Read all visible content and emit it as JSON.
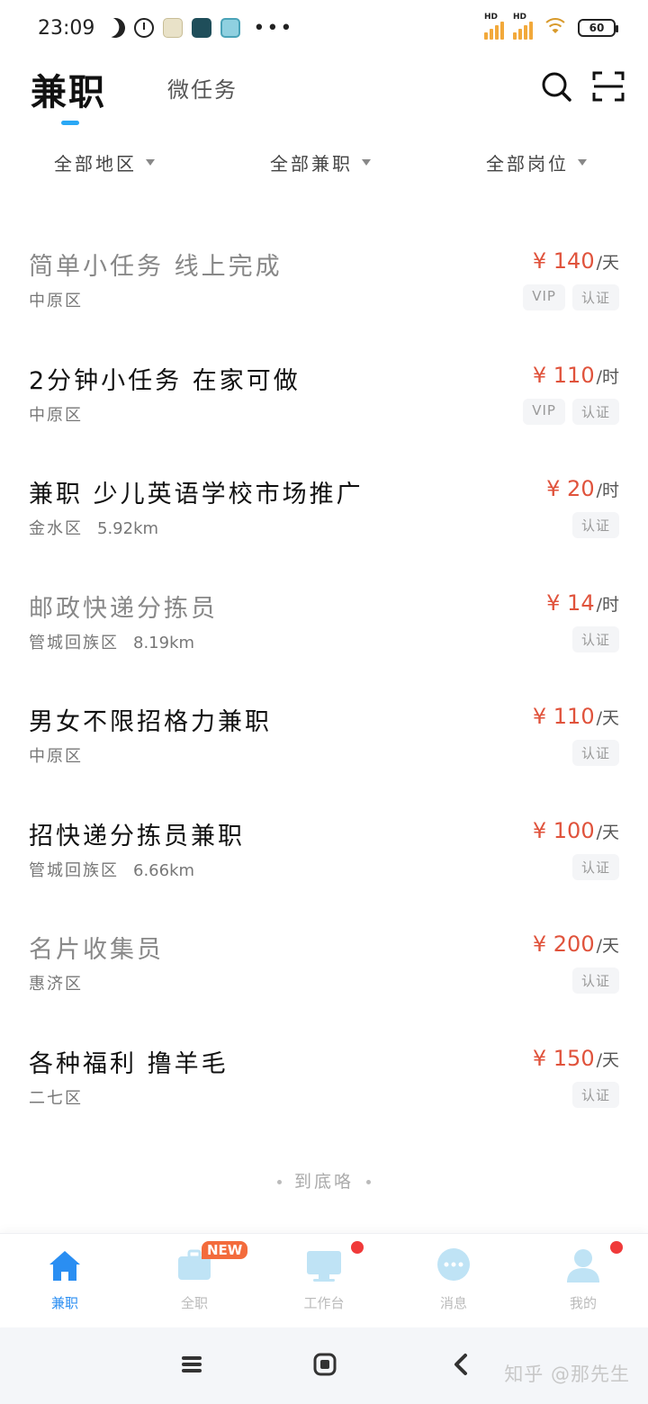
{
  "status_bar": {
    "time": "23:09",
    "signal_label_1": "HD",
    "signal_label_2": "HD",
    "battery": "60"
  },
  "header": {
    "active_tab": "兼职",
    "other_tab": "微任务"
  },
  "filters": [
    {
      "label": "全部地区"
    },
    {
      "label": "全部兼职"
    },
    {
      "label": "全部岗位"
    }
  ],
  "jobs": [
    {
      "title": "简单小任务 线上完成",
      "location": "中原区",
      "distance": "",
      "price": "¥ 140",
      "unit": "/天",
      "tags": [
        "VIP",
        "认证"
      ],
      "faded": true
    },
    {
      "title": "2分钟小任务 在家可做",
      "location": "中原区",
      "distance": "",
      "price": "¥ 110",
      "unit": "/时",
      "tags": [
        "VIP",
        "认证"
      ],
      "faded": false
    },
    {
      "title": "兼职  少儿英语学校市场推广",
      "location": "金水区",
      "distance": "5.92km",
      "price": "¥ 20",
      "unit": "/时",
      "tags": [
        "认证"
      ],
      "faded": false
    },
    {
      "title": "邮政快递分拣员",
      "location": "管城回族区",
      "distance": "8.19km",
      "price": "¥ 14",
      "unit": "/时",
      "tags": [
        "认证"
      ],
      "faded": true
    },
    {
      "title": "男女不限招格力兼职",
      "location": "中原区",
      "distance": "",
      "price": "¥ 110",
      "unit": "/天",
      "tags": [
        "认证"
      ],
      "faded": false
    },
    {
      "title": "招快递分拣员兼职",
      "location": "管城回族区",
      "distance": "6.66km",
      "price": "¥ 100",
      "unit": "/天",
      "tags": [
        "认证"
      ],
      "faded": false
    },
    {
      "title": "名片收集员",
      "location": "惠济区",
      "distance": "",
      "price": "¥ 200",
      "unit": "/天",
      "tags": [
        "认证"
      ],
      "faded": true
    },
    {
      "title": "各种福利 撸羊毛",
      "location": "二七区",
      "distance": "",
      "price": "¥ 150",
      "unit": "/天",
      "tags": [
        "认证"
      ],
      "faded": false
    }
  ],
  "end_hint": "到底咯",
  "bottom_nav": {
    "items": [
      {
        "label": "兼职",
        "icon": "home-icon"
      },
      {
        "label": "全职",
        "icon": "briefcase-icon",
        "badge": "NEW"
      },
      {
        "label": "工作台",
        "icon": "monitor-icon"
      },
      {
        "label": "消息",
        "icon": "chat-icon"
      },
      {
        "label": "我的",
        "icon": "person-icon"
      }
    ]
  },
  "watermark": "知乎 @那先生",
  "colors": {
    "accent_blue": "#2aa8f5",
    "price_red": "#e0533c",
    "badge_red": "#f03a3a"
  }
}
